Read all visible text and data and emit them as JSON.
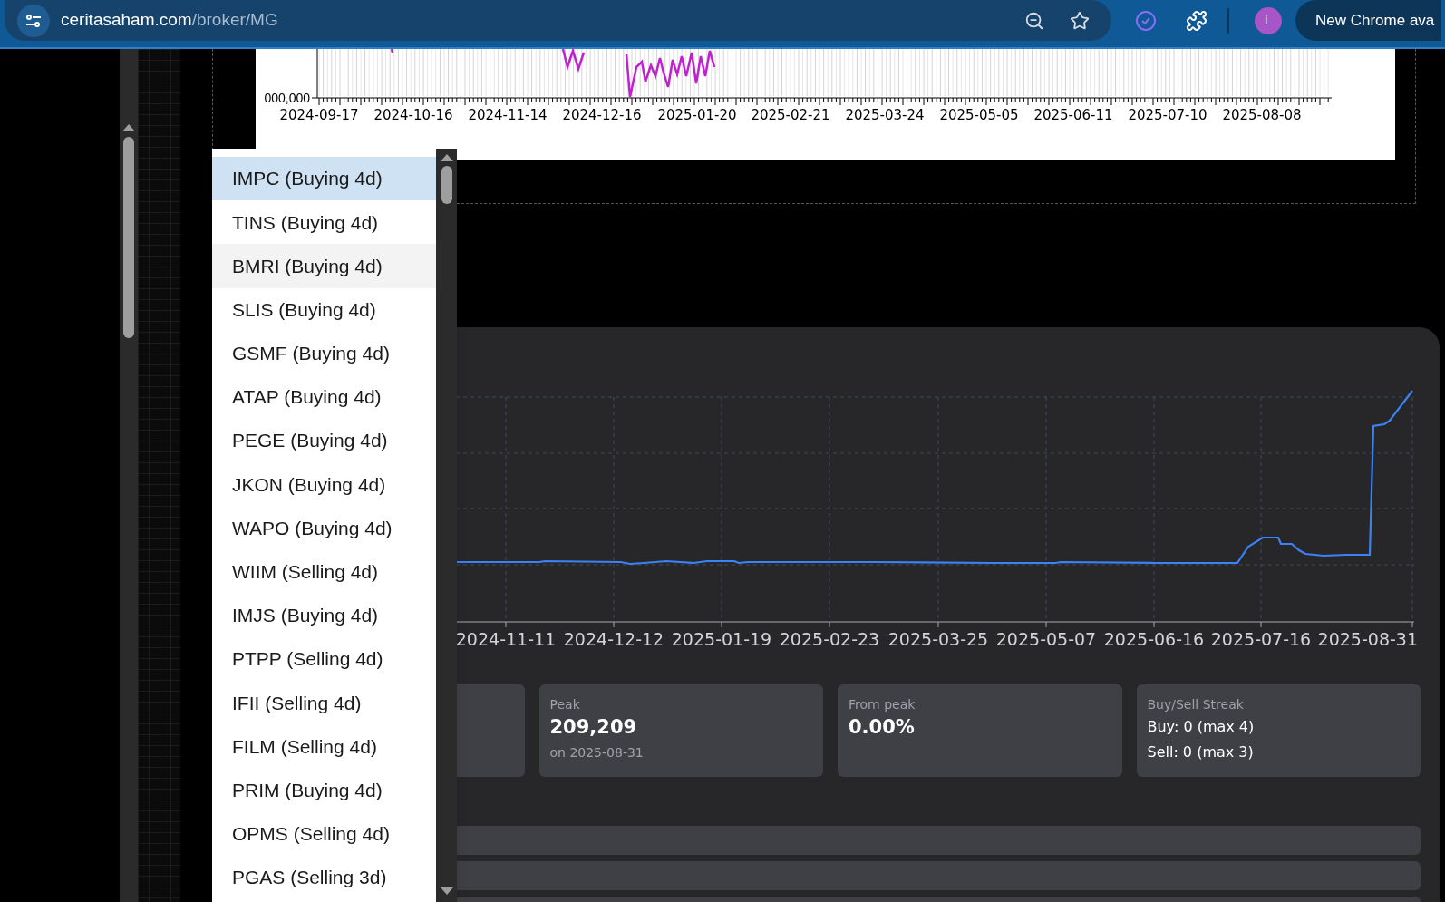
{
  "browser": {
    "url_host": "ceritasaham.com",
    "url_path": "/broker/MG",
    "profile_initial": "L",
    "update_button": "New Chrome ava"
  },
  "top_chart": {
    "y_tick": "000,000",
    "x_labels": [
      "2024-09-17",
      "2024-10-16",
      "2024-11-14",
      "2024-12-16",
      "2025-01-20",
      "2025-02-21",
      "2025-03-24",
      "2025-05-05",
      "2025-06-11",
      "2025-07-10",
      "2025-08-08"
    ]
  },
  "line_chart": {
    "x_labels": [
      "2024-11-11",
      "2024-12-12",
      "2025-01-19",
      "2025-02-23",
      "2025-03-25",
      "2025-05-07",
      "2025-06-16",
      "2025-07-16",
      "2025-08-31"
    ]
  },
  "stats": [
    {
      "kind": "value",
      "label": "Peak",
      "value": "209,209",
      "note": "on 2025-08-31"
    },
    {
      "kind": "value",
      "label": "From peak",
      "value": "0.00%"
    },
    {
      "kind": "lines",
      "label": "Buy/Sell Streak",
      "lines": [
        "Buy: 0 (max 4)",
        "Sell: 0 (max 3)"
      ]
    }
  ],
  "dropdown": {
    "items": [
      {
        "label": "IMPC (Buying 4d)",
        "selected": true,
        "highlighted": false
      },
      {
        "label": "TINS (Buying 4d)",
        "selected": false,
        "highlighted": false
      },
      {
        "label": "BMRI (Buying 4d)",
        "selected": false,
        "highlighted": true
      },
      {
        "label": "SLIS (Buying 4d)",
        "selected": false,
        "highlighted": false
      },
      {
        "label": "GSMF (Buying 4d)",
        "selected": false,
        "highlighted": false
      },
      {
        "label": "ATAP (Buying 4d)",
        "selected": false,
        "highlighted": false
      },
      {
        "label": "PEGE (Buying 4d)",
        "selected": false,
        "highlighted": false
      },
      {
        "label": "JKON (Buying 4d)",
        "selected": false,
        "highlighted": false
      },
      {
        "label": "WAPO (Buying 4d)",
        "selected": false,
        "highlighted": false
      },
      {
        "label": "WIIM (Selling 4d)",
        "selected": false,
        "highlighted": false
      },
      {
        "label": "IMJS (Buying 4d)",
        "selected": false,
        "highlighted": false
      },
      {
        "label": "PTPP (Selling 4d)",
        "selected": false,
        "highlighted": false
      },
      {
        "label": "IFII (Selling 4d)",
        "selected": false,
        "highlighted": false
      },
      {
        "label": "FILM (Selling 4d)",
        "selected": false,
        "highlighted": false
      },
      {
        "label": "PRIM (Buying 4d)",
        "selected": false,
        "highlighted": false
      },
      {
        "label": "OPMS (Selling 4d)",
        "selected": false,
        "highlighted": false
      },
      {
        "label": "PGAS (Selling 3d)",
        "selected": false,
        "highlighted": false
      }
    ]
  }
}
